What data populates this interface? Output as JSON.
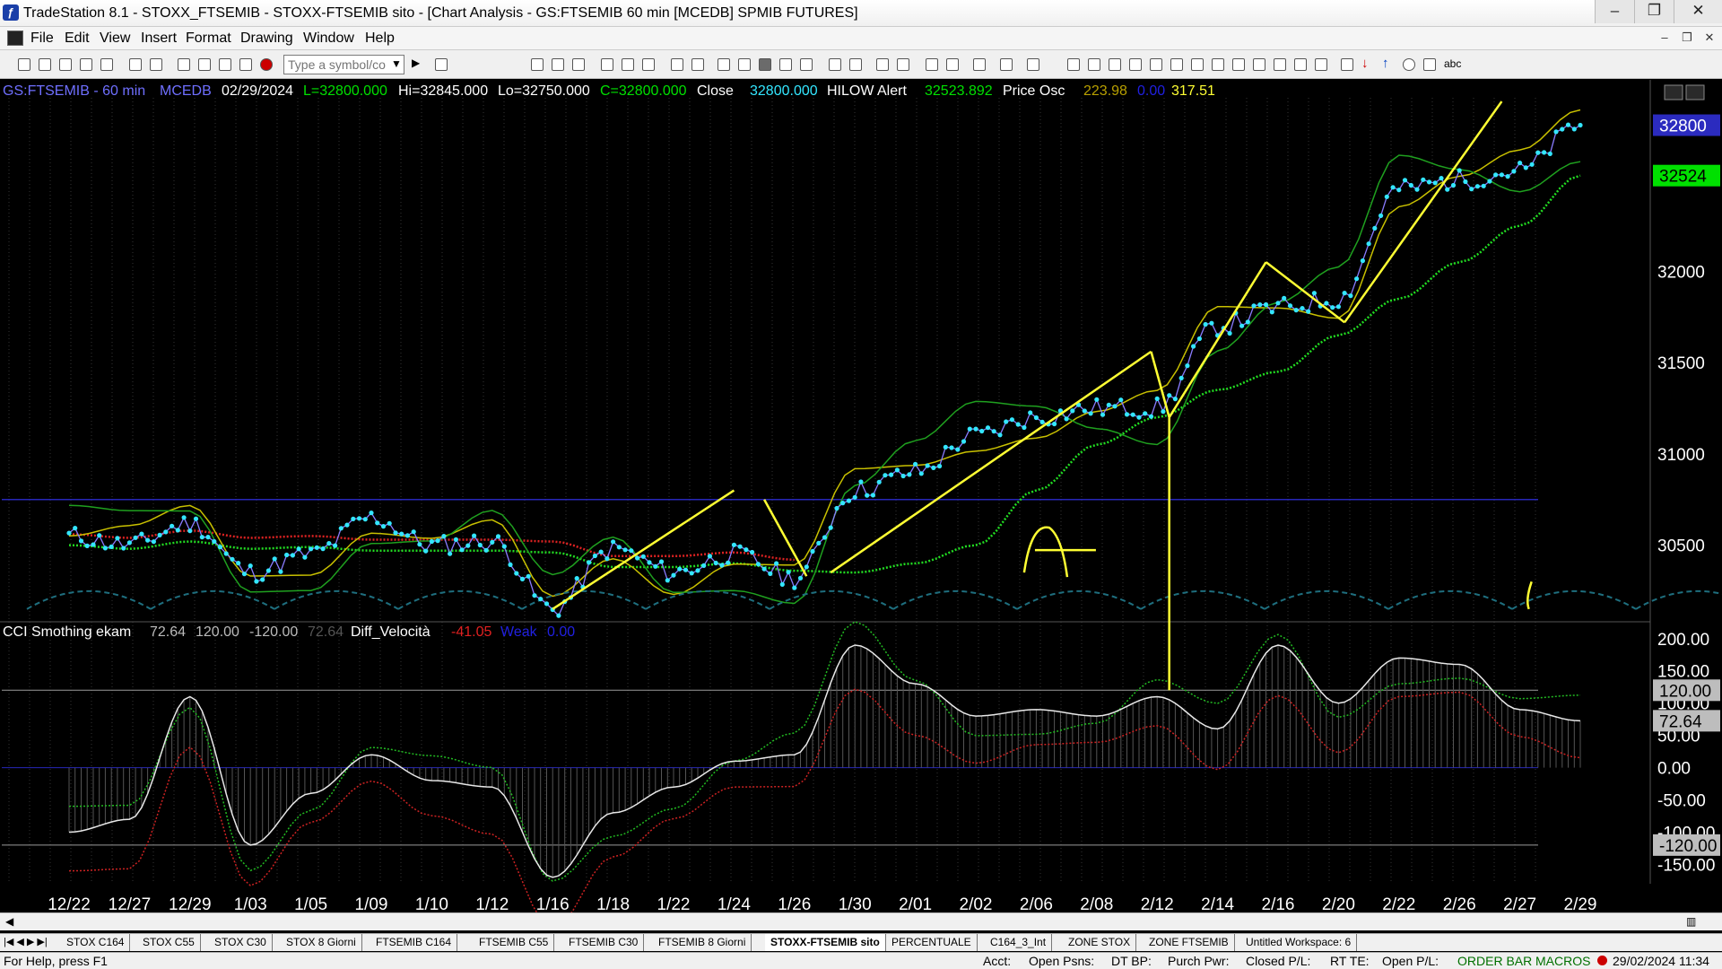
{
  "window": {
    "title": "TradeStation 8.1 - STOXX_FTSEMIB - STOXX-FTSEMIB sito - [Chart Analysis - GS:FTSEMIB  60 min  [MCEDB] SPMIB FUTURES]"
  },
  "menu": [
    "File",
    "Edit",
    "View",
    "Insert",
    "Format",
    "Drawing",
    "Window",
    "Help"
  ],
  "toolbar": {
    "symbol_placeholder": "Type a symbol/co",
    "draw_text_tool": "abc"
  },
  "chart_header": {
    "symbol": "GS:FTSEMIB - 60 min",
    "source": "MCEDB",
    "date": "02/29/2024",
    "last": "L=32800.000",
    "high": "Hi=32845.000",
    "low": "Lo=32750.000",
    "close": "C=32800.000",
    "close_label": "Close",
    "close_value": "32800.000",
    "hilow_label": "HILOW Alert",
    "hilow_value": "32523.892",
    "osc_label": "Price Osc",
    "osc_v1": "223.98",
    "osc_v2": "0.00",
    "osc_v3": "317.51"
  },
  "lower_header": {
    "label": "CCI Smothing ekam",
    "v1": "72.64",
    "v2": "120.00",
    "v3": "-120.00",
    "v4": "72.64",
    "diff_label": "Diff_Velocità",
    "diff_value": "-41.05",
    "weak_label": "Weak",
    "weak_value": "0.00"
  },
  "chart_data": [
    {
      "type": "line",
      "name": "price-panel",
      "x": [
        "12/22",
        "12/27",
        "12/29",
        "1/03",
        "1/05",
        "1/09",
        "1/10",
        "1/12",
        "1/16",
        "1/18",
        "1/22",
        "1/24",
        "1/26",
        "1/30",
        "2/01",
        "2/02",
        "2/06",
        "2/08",
        "2/12",
        "2/14",
        "2/16",
        "2/20",
        "2/22",
        "2/26",
        "2/27",
        "2/29"
      ],
      "y_ticks": [
        30500,
        31000,
        31500,
        32000
      ],
      "ylim": [
        30100,
        32950
      ],
      "price_tag": 32800,
      "hilow_tag": 32524,
      "reference_level": 30750,
      "series": [
        {
          "name": "Close",
          "values": [
            30550,
            30500,
            30620,
            30350,
            30450,
            30650,
            30500,
            30520,
            30150,
            30480,
            30350,
            30450,
            30320,
            30800,
            30900,
            31100,
            31200,
            31250,
            31250,
            31700,
            31800,
            31850,
            32450,
            32500,
            32550,
            32800
          ]
        },
        {
          "name": "HILOW Alert",
          "values": [
            30500,
            30480,
            30520,
            30480,
            30490,
            30470,
            30470,
            30470,
            30460,
            30380,
            30380,
            30400,
            30360,
            30350,
            30400,
            30500,
            30800,
            31050,
            31200,
            31350,
            31450,
            31650,
            31850,
            32050,
            32250,
            32524
          ]
        }
      ]
    },
    {
      "type": "line",
      "name": "cci-panel",
      "x": [
        "12/22",
        "12/27",
        "12/29",
        "1/03",
        "1/05",
        "1/09",
        "1/10",
        "1/12",
        "1/16",
        "1/18",
        "1/22",
        "1/24",
        "1/26",
        "1/30",
        "2/01",
        "2/02",
        "2/06",
        "2/08",
        "2/12",
        "2/14",
        "2/16",
        "2/20",
        "2/22",
        "2/26",
        "2/27",
        "2/29"
      ],
      "y_ticks": [
        200,
        150,
        100,
        50,
        0,
        -50,
        -100,
        -150
      ],
      "ylim": [
        -180,
        215
      ],
      "tags": [
        120,
        72.64,
        -120
      ],
      "series": [
        {
          "name": "CCI Smothing ekam",
          "values": [
            -100,
            -80,
            110,
            -120,
            -40,
            20,
            -20,
            -30,
            -170,
            -70,
            -30,
            10,
            20,
            190,
            130,
            80,
            90,
            80,
            110,
            60,
            190,
            100,
            170,
            160,
            90,
            72.64
          ]
        }
      ]
    }
  ],
  "workspace_tabs": [
    "STOX C164",
    "STOX C55",
    "STOX  C30",
    "STOX  8 Giorni",
    "FTSEMIB C164",
    "FTSEMIB C55",
    "FTSEMIB C30",
    "FTSEMIB  8 Giorni",
    "STOXX-FTSEMIB sito",
    "PERCENTUALE",
    "C164_3_Int",
    "ZONE STOX",
    "ZONE FTSEMIB",
    "Untitled Workspace: 6"
  ],
  "active_tab": "STOXX-FTSEMIB sito",
  "status": {
    "help": "For Help, press F1",
    "acct": "Acct:",
    "open_psns": "Open Psns:",
    "dt_bp": "DT BP:",
    "purch_pwr": "Purch Pwr:",
    "closed_pl": "Closed P/L:",
    "rt_te": "RT TE:",
    "open_pl": "Open P/L:",
    "order_bar": "ORDER BAR",
    "macros": "MACROS",
    "datetime": "29/02/2024 11:34"
  },
  "colors": {
    "price_line": "#8a7cff",
    "price_dots": "#33e6ff",
    "tag_blue": "#2b2bbf",
    "tag_green": "#00e000",
    "drawing_yellow": "#ffff33"
  }
}
